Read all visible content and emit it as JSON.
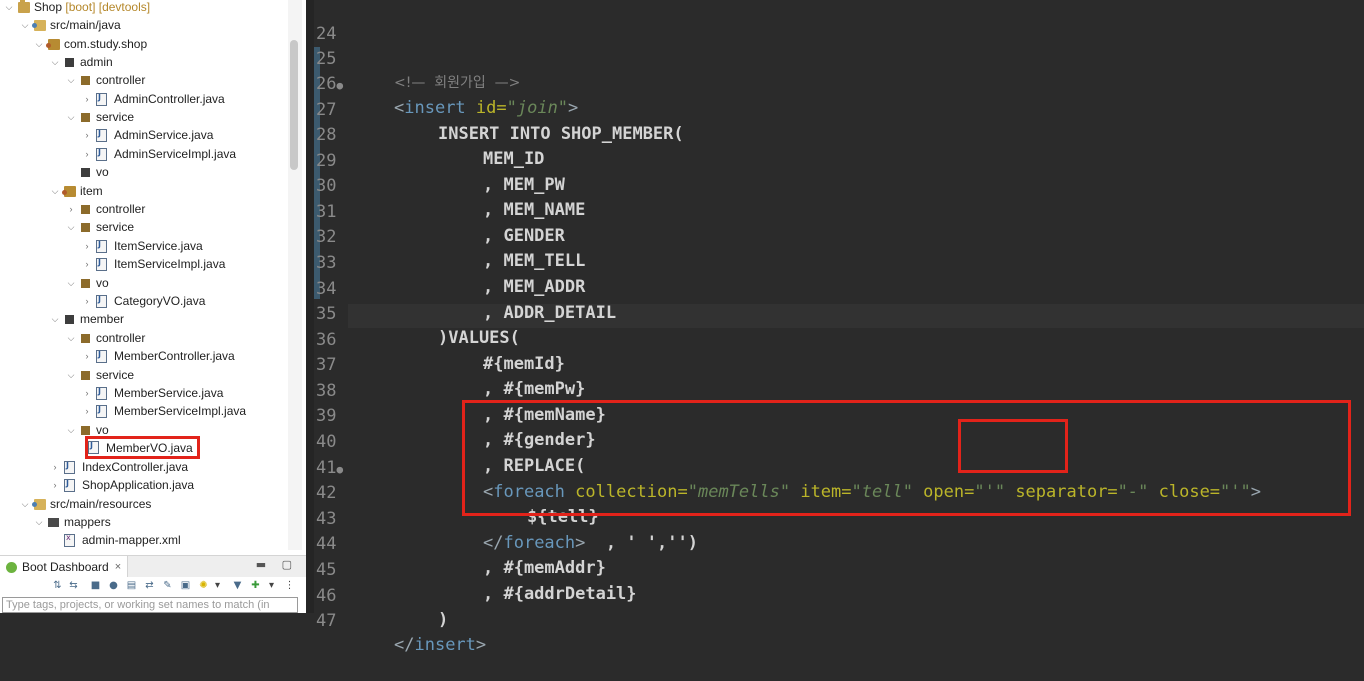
{
  "package_explorer": {
    "items": [
      {
        "label": "Shop",
        "decoration": "[boot] [devtools]",
        "type": "project",
        "expanded": true
      },
      {
        "label": "src/main/java",
        "type": "srcfolder",
        "expanded": true
      },
      {
        "label": "com.study.shop",
        "type": "pkgroot",
        "expanded": true
      },
      {
        "label": "admin",
        "type": "package",
        "expanded": true
      },
      {
        "label": "controller",
        "type": "package",
        "expanded": true
      },
      {
        "label": "AdminController.java",
        "type": "java",
        "expanded": false
      },
      {
        "label": "service",
        "type": "package",
        "expanded": true
      },
      {
        "label": "AdminService.java",
        "type": "java",
        "expanded": false
      },
      {
        "label": "AdminServiceImpl.java",
        "type": "java",
        "expanded": false
      },
      {
        "label": "vo",
        "type": "package-empty"
      },
      {
        "label": "item",
        "type": "pkgroot",
        "expanded": true
      },
      {
        "label": "controller",
        "type": "package",
        "expanded": false
      },
      {
        "label": "service",
        "type": "package",
        "expanded": true
      },
      {
        "label": "ItemService.java",
        "type": "java",
        "expanded": false
      },
      {
        "label": "ItemServiceImpl.java",
        "type": "java",
        "expanded": false
      },
      {
        "label": "vo",
        "type": "package",
        "expanded": true
      },
      {
        "label": "CategoryVO.java",
        "type": "java",
        "expanded": false
      },
      {
        "label": "member",
        "type": "package-empty",
        "expanded": true
      },
      {
        "label": "controller",
        "type": "package",
        "expanded": true
      },
      {
        "label": "MemberController.java",
        "type": "java",
        "expanded": false
      },
      {
        "label": "service",
        "type": "package",
        "expanded": true
      },
      {
        "label": "MemberService.java",
        "type": "java",
        "expanded": false
      },
      {
        "label": "MemberServiceImpl.java",
        "type": "java",
        "expanded": false
      },
      {
        "label": "vo",
        "type": "package",
        "expanded": true
      },
      {
        "label": "MemberVO.java",
        "type": "java",
        "highlighted": true
      },
      {
        "label": "IndexController.java",
        "type": "java",
        "expanded": false
      },
      {
        "label": "ShopApplication.java",
        "type": "java",
        "expanded": false
      },
      {
        "label": "src/main/resources",
        "type": "srcfolder",
        "expanded": true
      },
      {
        "label": "mappers",
        "type": "mappers",
        "expanded": true
      },
      {
        "label": "admin-mapper.xml",
        "type": "xml"
      }
    ]
  },
  "boot_dashboard": {
    "title": "Boot Dashboard",
    "close": "×",
    "filter_placeholder": "Type tags, projects, or working set names to match (in"
  },
  "editor": {
    "lines": [
      {
        "n": "24",
        "marker": ""
      },
      {
        "n": "25",
        "marker": ""
      },
      {
        "n": "26",
        "marker": "●"
      },
      {
        "n": "27",
        "marker": ""
      },
      {
        "n": "28",
        "marker": ""
      },
      {
        "n": "29",
        "marker": ""
      },
      {
        "n": "30",
        "marker": ""
      },
      {
        "n": "31",
        "marker": ""
      },
      {
        "n": "32",
        "marker": ""
      },
      {
        "n": "33",
        "marker": ""
      },
      {
        "n": "34",
        "marker": ""
      },
      {
        "n": "35",
        "marker": ""
      },
      {
        "n": "36",
        "marker": ""
      },
      {
        "n": "37",
        "marker": ""
      },
      {
        "n": "38",
        "marker": ""
      },
      {
        "n": "39",
        "marker": ""
      },
      {
        "n": "40",
        "marker": ""
      },
      {
        "n": "41",
        "marker": "●"
      },
      {
        "n": "42",
        "marker": ""
      },
      {
        "n": "43",
        "marker": ""
      },
      {
        "n": "44",
        "marker": ""
      },
      {
        "n": "45",
        "marker": ""
      },
      {
        "n": "46",
        "marker": ""
      },
      {
        "n": "47",
        "marker": ""
      }
    ],
    "code": {
      "l25": "<!—  회원가입  —>",
      "l26_open": "<",
      "l26_tag": "insert",
      "l26_attr": " id=",
      "l26_val": "\"join\"",
      "l26_close": ">",
      "l27": "INSERT INTO SHOP_MEMBER(",
      "l28": "MEM_ID",
      "l29": ", MEM_PW",
      "l30": ", MEM_NAME",
      "l31": ", GENDER",
      "l32": ", MEM_TELL",
      "l33": ", MEM_ADDR",
      "l34": ", ADDR_DETAIL",
      "l35": ")VALUES(",
      "l36": "#{memId}",
      "l37": ", #{memPw}",
      "l38": ", #{memName}",
      "l39": ", #{gender}",
      "l40": ", REPLACE(",
      "l41_open": "<",
      "l41_tag": "foreach",
      "l41_a1": " collection=",
      "l41_v1": "\"memTells\"",
      "l41_a2": " item=",
      "l41_v2": "\"tell\"",
      "l41_a3": " open=",
      "l41_v3": "\"'\"",
      "l41_a4": " separator=",
      "l41_v4": "\"-\"",
      "l41_a5": " close=",
      "l41_v5": "\"'\"",
      "l41_close": ">",
      "l42": "${tell}",
      "l43_open": "</",
      "l43_tag": "foreach",
      "l43_close": ">",
      "l43_rest": "  , ' ','')",
      "l44": ", #{memAddr}",
      "l45": ", #{addrDetail}",
      "l46": ")",
      "l47_open": "</",
      "l47_tag": "insert",
      "l47_close": ">"
    }
  }
}
